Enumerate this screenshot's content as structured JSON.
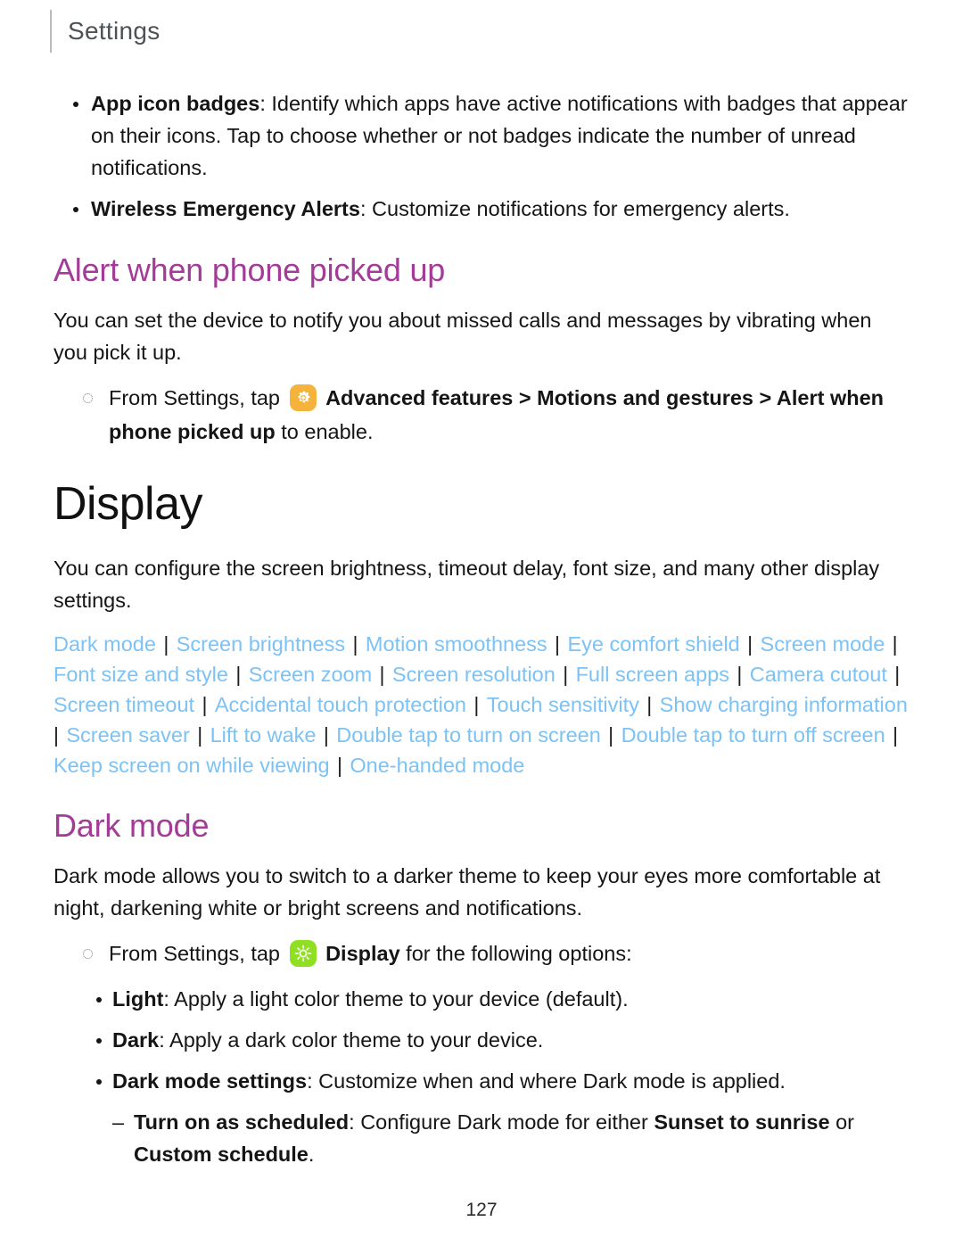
{
  "header": {
    "title": "Settings"
  },
  "intro_bullets": [
    {
      "term": "App icon badges",
      "text": ": Identify which apps have active notifications with badges that appear on their icons. Tap to choose whether or not badges indicate the number of unread notifications."
    },
    {
      "term": "Wireless Emergency Alerts",
      "text": ": Customize notifications for emergency alerts."
    }
  ],
  "alert_section": {
    "heading": "Alert when phone picked up",
    "paragraph": "You can set the device to notify you about missed calls and messages by vibrating when you pick it up.",
    "step": {
      "lead": "From Settings, tap",
      "icon_name": "advanced-features-icon",
      "icon_color": "#f5b33c",
      "bold_path": "Advanced features > Motions and gestures > Alert when phone picked up",
      "tail": " to enable."
    }
  },
  "display_section": {
    "heading": "Display",
    "paragraph": "You can configure the screen brightness, timeout delay, font size, and many other display settings.",
    "links": [
      "Dark mode",
      "Screen brightness",
      "Motion smoothness",
      "Eye comfort shield",
      "Screen mode",
      "Font size and style",
      "Screen zoom",
      "Screen resolution",
      "Full screen apps",
      "Camera cutout",
      "Screen timeout",
      "Accidental touch protection",
      "Touch sensitivity",
      "Show charging information",
      "Screen saver",
      "Lift to wake",
      "Double tap to turn on screen",
      "Double tap to turn off screen",
      "Keep screen on while viewing",
      "One-handed mode"
    ],
    "link_color": "#7cc2f4",
    "separator": "|"
  },
  "dark_mode_section": {
    "heading": "Dark mode",
    "heading_color": "#a23c97",
    "paragraph": "Dark mode allows you to switch to a darker theme to keep your eyes more comfortable at night, darkening white or bright screens and notifications.",
    "step": {
      "lead": "From Settings, tap",
      "icon_name": "display-icon",
      "icon_color": "#8fe023",
      "bold_path": "Display",
      "tail": " for the following options:"
    },
    "options": [
      {
        "term": "Light",
        "text": ": Apply a light color theme to your device (default)."
      },
      {
        "term": "Dark",
        "text": ": Apply a dark color theme to your device."
      },
      {
        "term": "Dark mode settings",
        "text": ": Customize when and where Dark mode is applied."
      }
    ],
    "sub_options": [
      {
        "term": "Turn on as scheduled",
        "text_a": ": Configure Dark mode for either ",
        "bold_b": "Sunset to sunrise",
        "text_c": " or ",
        "bold_d": "Custom schedule",
        "text_e": "."
      }
    ]
  },
  "footer": {
    "page_number": "127"
  }
}
